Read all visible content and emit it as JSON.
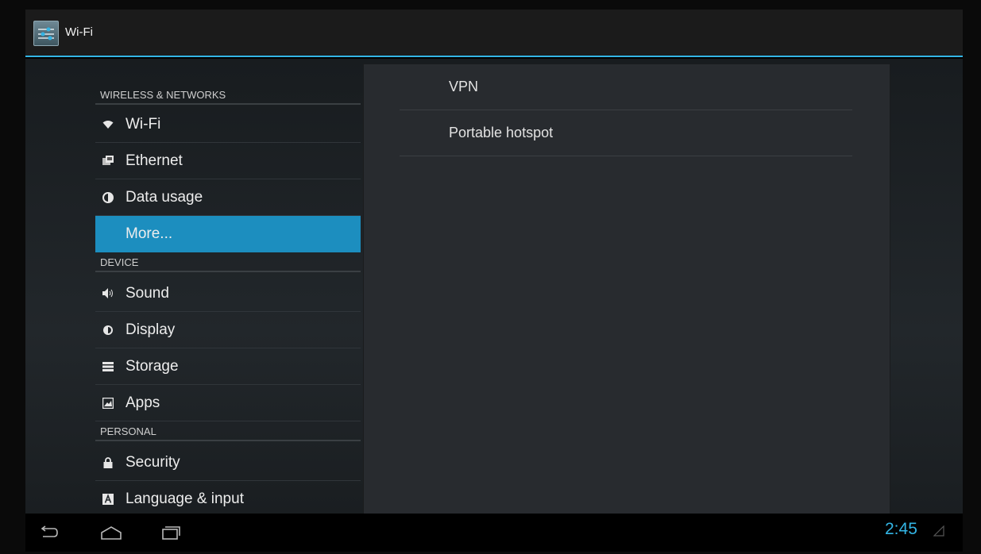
{
  "actionbar": {
    "title": "Wi-Fi"
  },
  "sidebar": {
    "sections": [
      {
        "header": "WIRELESS & NETWORKS",
        "items": [
          {
            "label": "Wi-Fi",
            "icon": "wifi-icon"
          },
          {
            "label": "Ethernet",
            "icon": "ethernet-icon"
          },
          {
            "label": "Data usage",
            "icon": "data-usage-icon"
          },
          {
            "label": "More...",
            "icon": null,
            "selected": true
          }
        ]
      },
      {
        "header": "DEVICE",
        "items": [
          {
            "label": "Sound",
            "icon": "sound-icon"
          },
          {
            "label": "Display",
            "icon": "display-icon"
          },
          {
            "label": "Storage",
            "icon": "storage-icon"
          },
          {
            "label": "Apps",
            "icon": "apps-icon"
          }
        ]
      },
      {
        "header": "PERSONAL",
        "items": [
          {
            "label": "Security",
            "icon": "lock-icon"
          },
          {
            "label": "Language & input",
            "icon": "language-icon"
          }
        ]
      }
    ]
  },
  "detail": {
    "items": [
      {
        "label": "VPN"
      },
      {
        "label": "Portable hotspot"
      }
    ]
  },
  "statusbar": {
    "clock": "2:45"
  },
  "colors": {
    "accent": "#33b5e5",
    "selected": "#1c8ebf"
  }
}
